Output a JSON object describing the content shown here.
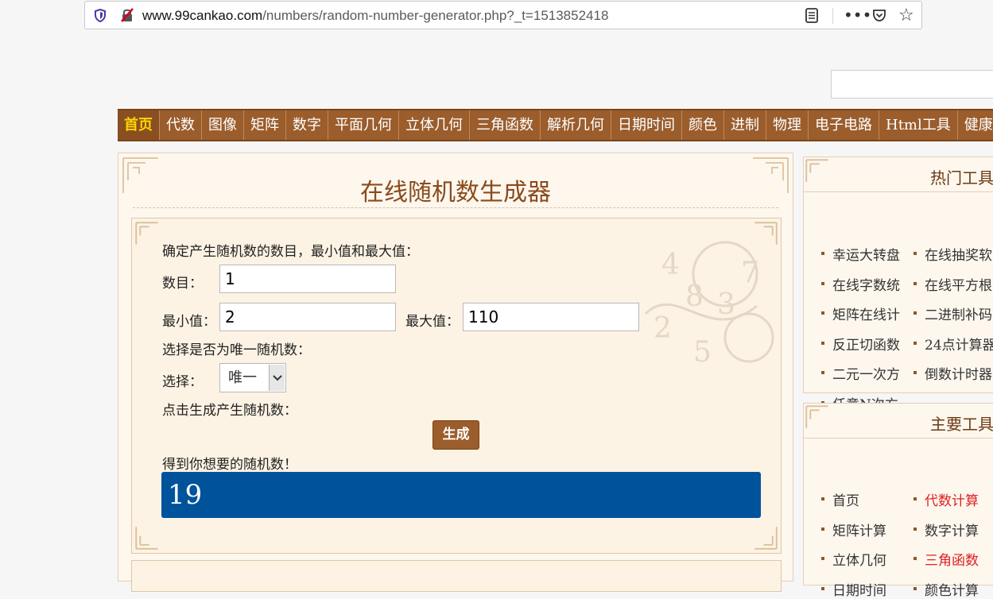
{
  "browser": {
    "url_domain": "www.99cankao.com",
    "url_path": "/numbers/random-number-generator.php?_t=1513852418",
    "icons": [
      "shield-icon",
      "insecure-lock-icon",
      "reader-view-icon",
      "more-icon",
      "pocket-icon",
      "bookmark-star-icon"
    ]
  },
  "nav": {
    "items": [
      "首页",
      "代数",
      "图像",
      "矩阵",
      "数字",
      "平面几何",
      "立体几何",
      "三角函数",
      "解析几何",
      "日期时间",
      "颜色",
      "进制",
      "物理",
      "电子电路",
      "Html工具",
      "健康"
    ],
    "active_index": 0
  },
  "main": {
    "title": "在线随机数生成器",
    "intro": "确定产生随机数的数目，最小值和最大值：",
    "count_label": "数目：",
    "count_value": "1",
    "min_label": "最小值：",
    "min_value": "2",
    "max_label": "最大值：",
    "max_value": "110",
    "unique_prompt": "选择是否为唯一随机数：",
    "select_label": "选择：",
    "select_value": "唯一",
    "generate_prompt": "点击生成产生随机数：",
    "generate_button": "生成",
    "result_prompt": "得到你想要的随机数！",
    "result_value": "19"
  },
  "sidebar": {
    "hot_tools": {
      "title": "热门工具",
      "items": [
        {
          "label": "幸运大转盘"
        },
        {
          "label": "在线抽奖软"
        },
        {
          "label": "在线字数统"
        },
        {
          "label": "在线平方根"
        },
        {
          "label": "矩阵在线计"
        },
        {
          "label": "二进制补码"
        },
        {
          "label": "反正切函数"
        },
        {
          "label": "24点计算器"
        },
        {
          "label": "二元一次方"
        },
        {
          "label": "倒数计时器"
        },
        {
          "label": "任意N次方"
        }
      ]
    },
    "main_tools": {
      "title": "主要工具",
      "items": [
        {
          "label": "首页",
          "highlight": false
        },
        {
          "label": "代数计算",
          "highlight": true
        },
        {
          "label": "矩阵计算",
          "highlight": false
        },
        {
          "label": "数字计算",
          "highlight": false
        },
        {
          "label": "立体几何",
          "highlight": false
        },
        {
          "label": "三角函数",
          "highlight": true
        },
        {
          "label": "日期时间",
          "highlight": false
        },
        {
          "label": "颜色计算",
          "highlight": false
        }
      ]
    }
  }
}
